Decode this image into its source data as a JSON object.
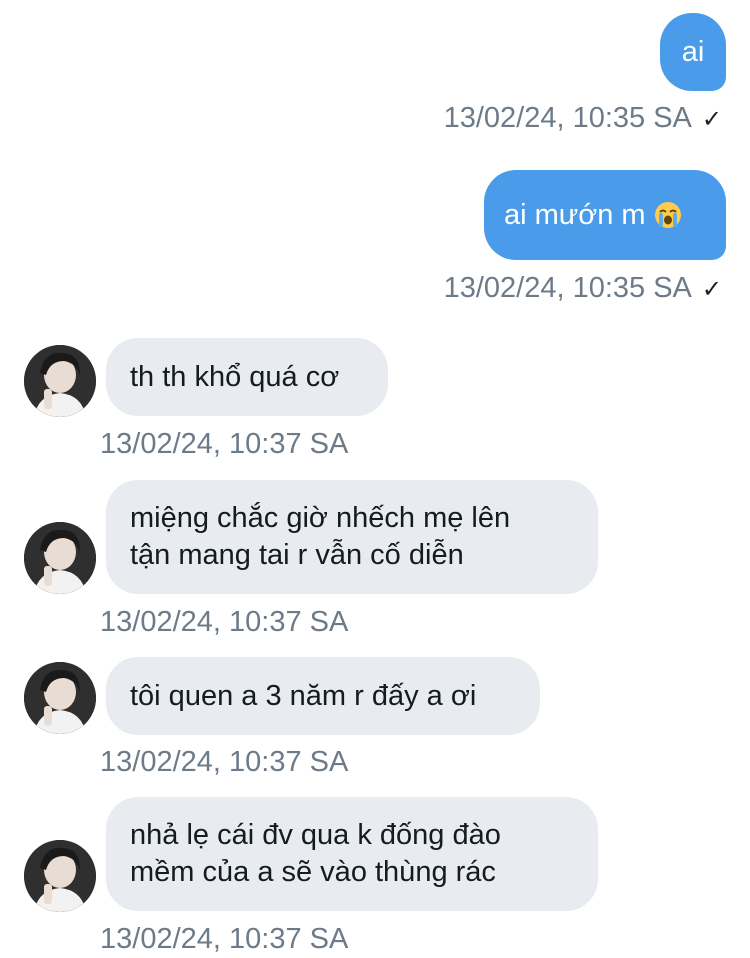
{
  "messages": [
    {
      "direction": "outgoing",
      "text": "ai",
      "timestamp": "13/02/24, 10:35 SA",
      "status_icon": "check-icon",
      "status_glyph": "✓"
    },
    {
      "direction": "outgoing",
      "text": "ai mướn m",
      "emoji": "loudly-crying-face",
      "timestamp": "13/02/24, 10:35 SA",
      "status_icon": "check-icon",
      "status_glyph": "✓"
    },
    {
      "direction": "incoming",
      "text": "th th khổ quá cơ",
      "timestamp": "13/02/24, 10:37 SA"
    },
    {
      "direction": "incoming",
      "text": "miệng chắc giờ nhếch mẹ lên\ntận mang tai r vẫn cố diễn",
      "timestamp": "13/02/24, 10:37 SA"
    },
    {
      "direction": "incoming",
      "text": "tôi quen a 3 năm r đấy a ơi",
      "timestamp": "13/02/24, 10:37 SA"
    },
    {
      "direction": "incoming",
      "text": "nhả lẹ cái đv qua k đống đào\nmềm của a sẽ vào thùng rác",
      "timestamp": "13/02/24, 10:37 SA"
    }
  ],
  "colors": {
    "outgoing_bubble": "#4a9ceb",
    "incoming_bubble": "#e8ebef",
    "timestamp_text": "#6d7b89",
    "background": "#ffffff"
  }
}
